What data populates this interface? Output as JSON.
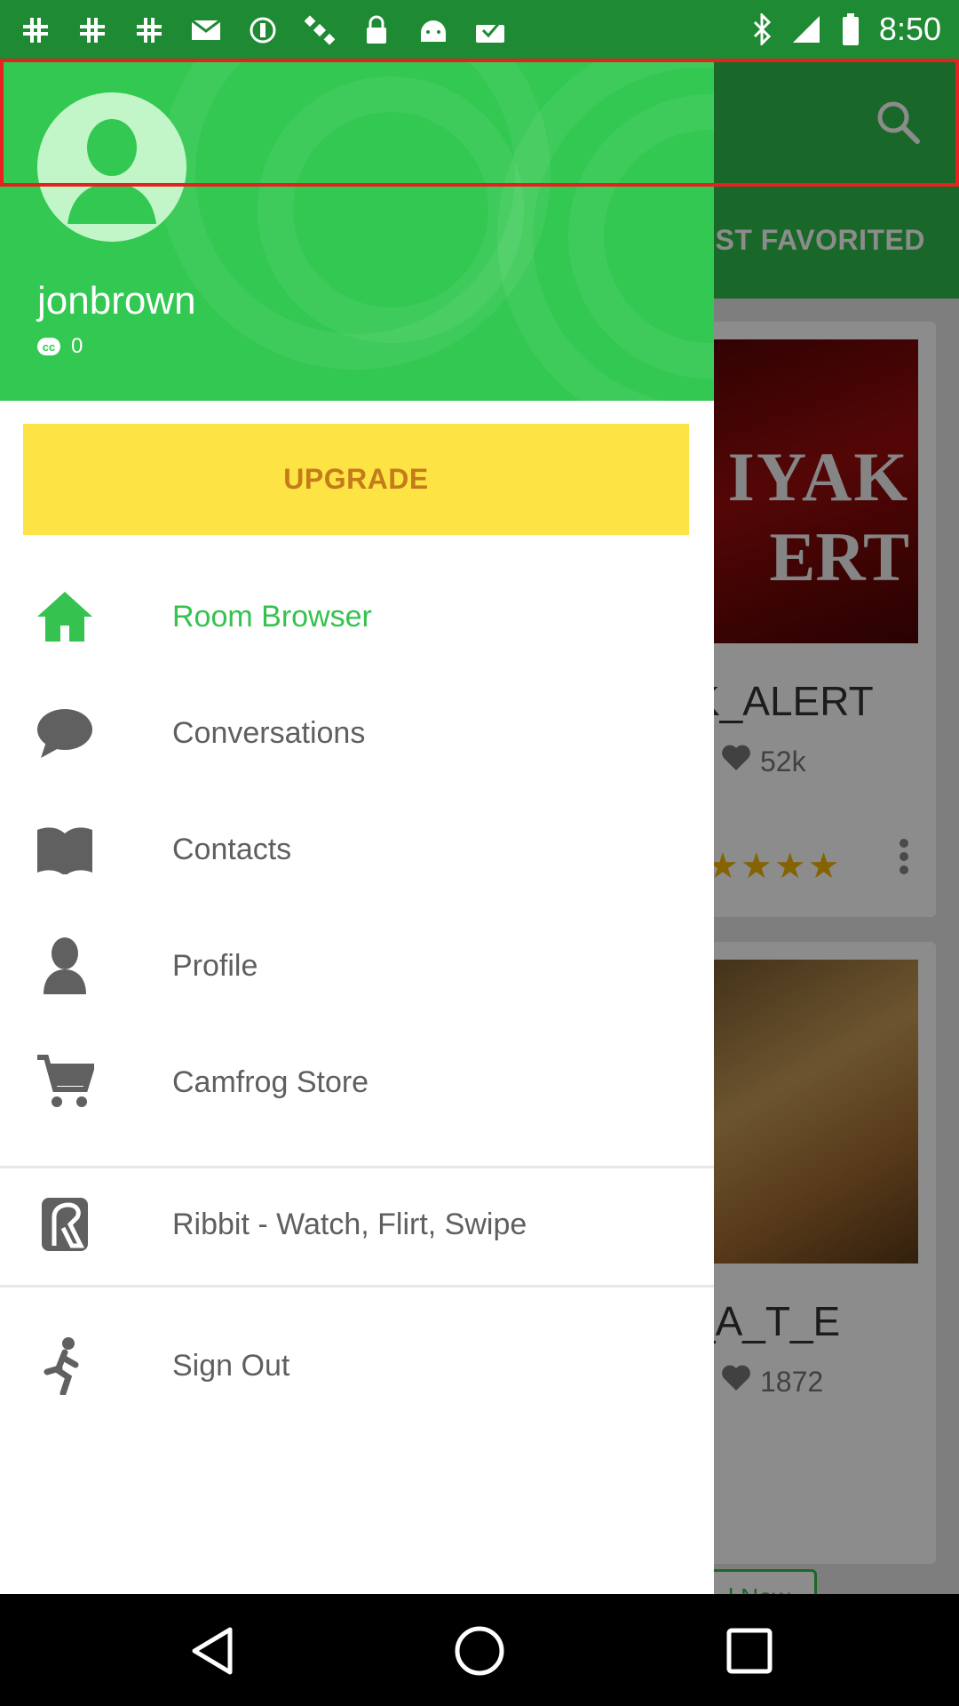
{
  "status_bar": {
    "time": "8:50",
    "icons": [
      "slack-icon",
      "slack-icon",
      "slack-icon",
      "mail-icon",
      "sync-icon",
      "satellite-icon",
      "lock-icon",
      "android-icon",
      "upload-icon"
    ]
  },
  "background_app": {
    "tab_label": "MOST FAVORITED",
    "cards": [
      {
        "name": "NAAYAK_ALERT",
        "visible_name": "K_ALERT",
        "thumb_text_1": "IYAK",
        "thumb_text_2": "ERT",
        "likes": "52k",
        "rating_stars": 3.5
      },
      {
        "name": "_A_T_E",
        "visible_name": "_A_T_E",
        "likes": "1872"
      }
    ],
    "join_button": "l Now"
  },
  "drawer": {
    "username": "jonbrown",
    "credits": "0",
    "upgrade_label": "UPGRADE",
    "menu": [
      {
        "label": "Room Browser",
        "icon": "home-icon",
        "active": true
      },
      {
        "label": "Conversations",
        "icon": "chat-bubble-icon",
        "active": false
      },
      {
        "label": "Contacts",
        "icon": "book-icon",
        "active": false
      },
      {
        "label": "Profile",
        "icon": "person-icon",
        "active": false
      },
      {
        "label": "Camfrog Store",
        "icon": "cart-icon",
        "active": false
      },
      {
        "label": "Ribbit - Watch, Flirt, Swipe",
        "icon": "ribbit-icon",
        "active": false
      },
      {
        "label": "Sign Out",
        "icon": "running-man-icon",
        "active": false
      }
    ]
  },
  "colors": {
    "brand_green": "#33c851",
    "upgrade_yellow": "#fde444",
    "upgrade_text": "#c47c1a",
    "highlight_red": "#e8211f"
  }
}
